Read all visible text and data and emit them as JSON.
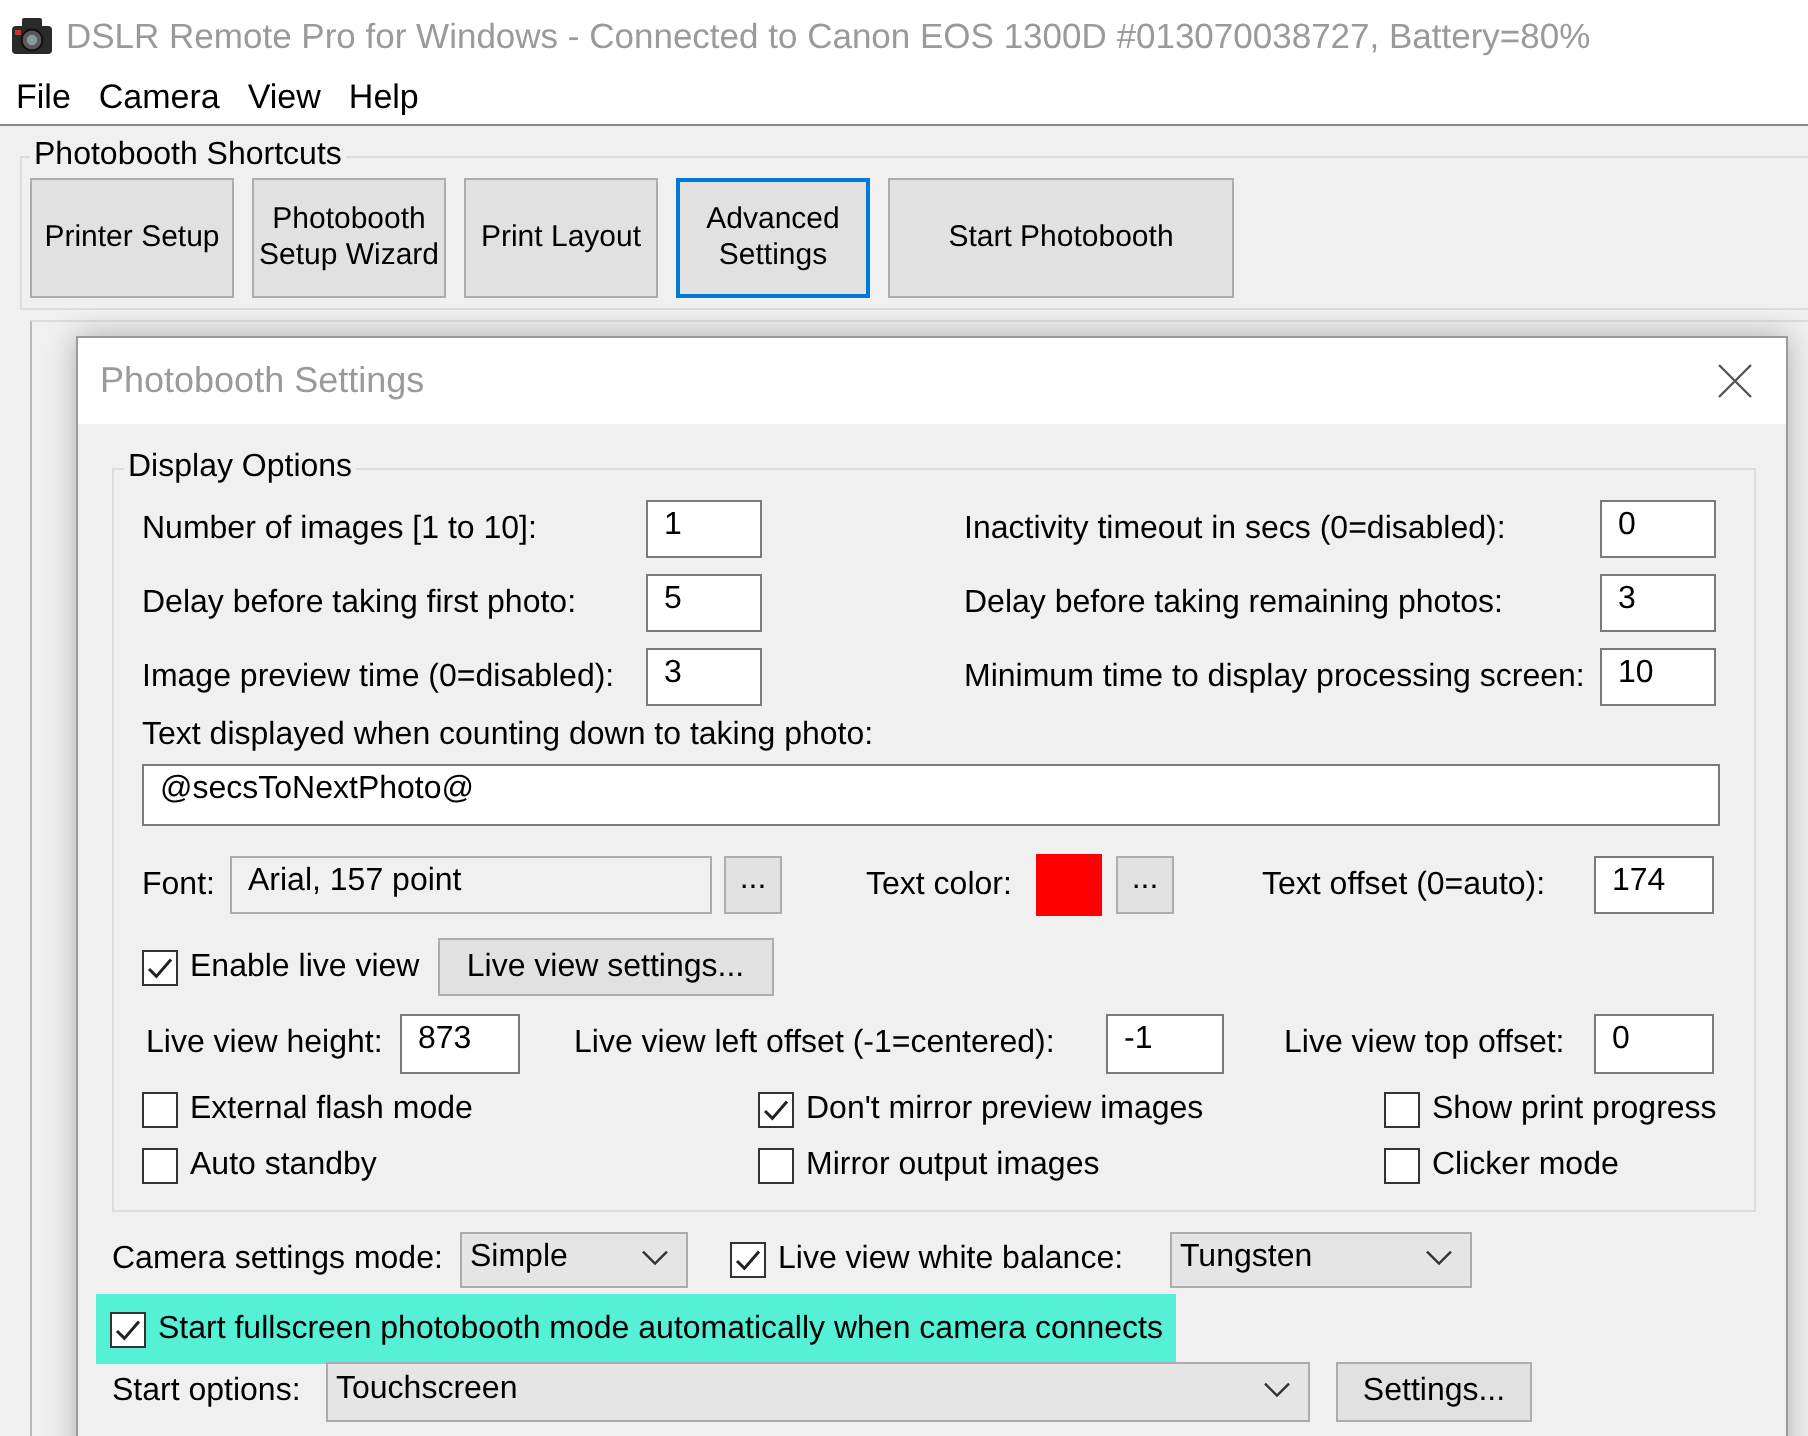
{
  "window": {
    "title": "DSLR Remote Pro for Windows - Connected to Canon EOS 1300D #013070038727, Battery=80%"
  },
  "menu": [
    "File",
    "Camera",
    "View",
    "Help"
  ],
  "shortcuts": {
    "title": "Photobooth Shortcuts",
    "buttons": [
      {
        "label": "Printer Setup",
        "focused": false
      },
      {
        "label": "Photobooth Setup Wizard",
        "focused": false
      },
      {
        "label": "Print Layout",
        "focused": false
      },
      {
        "label": "Advanced Settings",
        "focused": true
      },
      {
        "label": "Start Photobooth",
        "focused": false
      }
    ]
  },
  "dialog": {
    "title": "Photobooth Settings",
    "display_options": {
      "title": "Display Options",
      "fields": [
        {
          "label": "Number of images [1 to 10]:",
          "value": "1"
        },
        {
          "label": "Inactivity timeout in secs (0=disabled):",
          "value": "0"
        },
        {
          "label": "Delay before taking first photo:",
          "value": "5"
        },
        {
          "label": "Delay before taking remaining photos:",
          "value": "3"
        },
        {
          "label": "Image preview time (0=disabled):",
          "value": "3"
        },
        {
          "label": "Minimum time to display processing screen:",
          "value": "10"
        }
      ],
      "countdown_text": {
        "label": "Text displayed when counting down to taking photo:",
        "value": "@secsToNextPhoto@"
      },
      "font": {
        "label": "Font:",
        "value": "Arial, 157 point",
        "button": "..."
      },
      "text_color": {
        "label": "Text color:",
        "color": "#ff0000",
        "button": "..."
      },
      "text_offset": {
        "label": "Text offset (0=auto):",
        "value": "174"
      },
      "live_view": {
        "label": "Enable live view",
        "checked": true,
        "button": "Live view settings..."
      },
      "live_view_fields": [
        {
          "label": "Live view height:",
          "value": "873"
        },
        {
          "label": "Live view left offset (-1=centered):",
          "value": "-1"
        },
        {
          "label": "Live view top offset:",
          "value": "0"
        }
      ],
      "options": [
        {
          "label": "External flash mode",
          "checked": false
        },
        {
          "label": "Don't mirror preview images",
          "checked": true
        },
        {
          "label": "Show print progress",
          "checked": false
        },
        {
          "label": "Auto standby",
          "checked": false
        },
        {
          "label": "Mirror output images",
          "checked": false
        },
        {
          "label": "Clicker mode",
          "checked": false
        }
      ]
    },
    "camera_settings_mode": {
      "label": "Camera settings mode:",
      "value": "Simple"
    },
    "white_balance": {
      "label": "Live view white balance:",
      "checked": true,
      "value": "Tungsten"
    },
    "auto_start": {
      "label": "Start fullscreen photobooth mode automatically when camera connects",
      "checked": true,
      "highlighted": true
    },
    "start_options": {
      "label": "Start options:",
      "value": "Touchscreen",
      "button": "Settings..."
    }
  }
}
